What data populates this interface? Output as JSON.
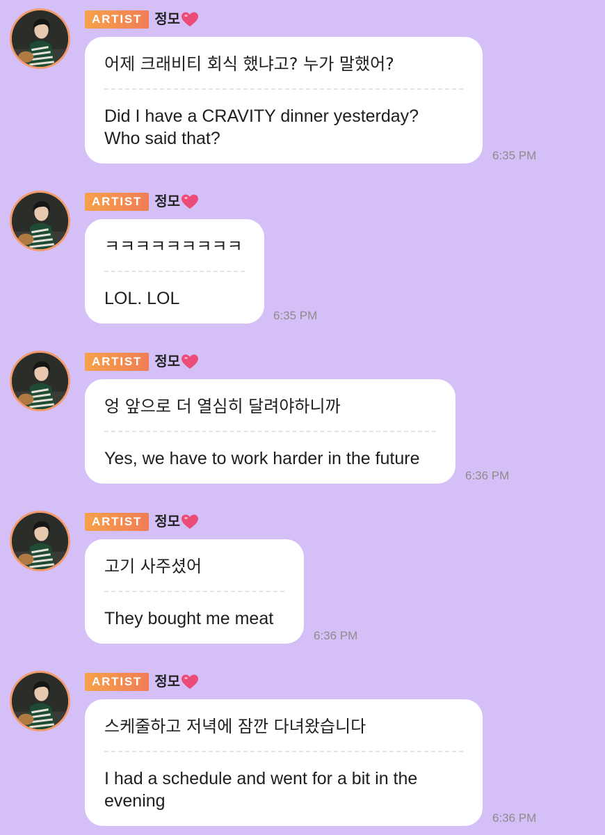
{
  "colors": {
    "background": "#d4c0f6",
    "bubble": "#ffffff",
    "badge_start": "#f6a14a",
    "badge_end": "#f07d55",
    "heart": "#ec4c78",
    "avatar_ring": "#f39a6a",
    "timestamp": "#8c8c8c"
  },
  "icons": {
    "heart": "heart-icon",
    "avatar": "artist-avatar-photo"
  },
  "messages": [
    {
      "badge": "ARTIST",
      "sender": "정모",
      "ko": "어제 크래비티 회식 했냐고? 누가 말했어?",
      "en": "Did I have a CRAVITY dinner yesterday?\nWho said that?",
      "time": "6:35 PM"
    },
    {
      "badge": "ARTIST",
      "sender": "정모",
      "ko": "ㅋㅋㅋㅋㅋㅋㅋㅋㅋ",
      "en": "LOL. LOL",
      "time": "6:35 PM"
    },
    {
      "badge": "ARTIST",
      "sender": "정모",
      "ko": "엉 앞으로 더 열심히 달려야하니까",
      "en": "Yes, we have to work harder in the future",
      "time": "6:36 PM"
    },
    {
      "badge": "ARTIST",
      "sender": "정모",
      "ko": "고기 사주셨어",
      "en": "They bought me meat",
      "time": "6:36 PM"
    },
    {
      "badge": "ARTIST",
      "sender": "정모",
      "ko": "스케줄하고 저녁에 잠깐 다녀왔습니다",
      "en": "I had a schedule and went for a bit in the\nevening",
      "time": "6:36 PM"
    }
  ]
}
